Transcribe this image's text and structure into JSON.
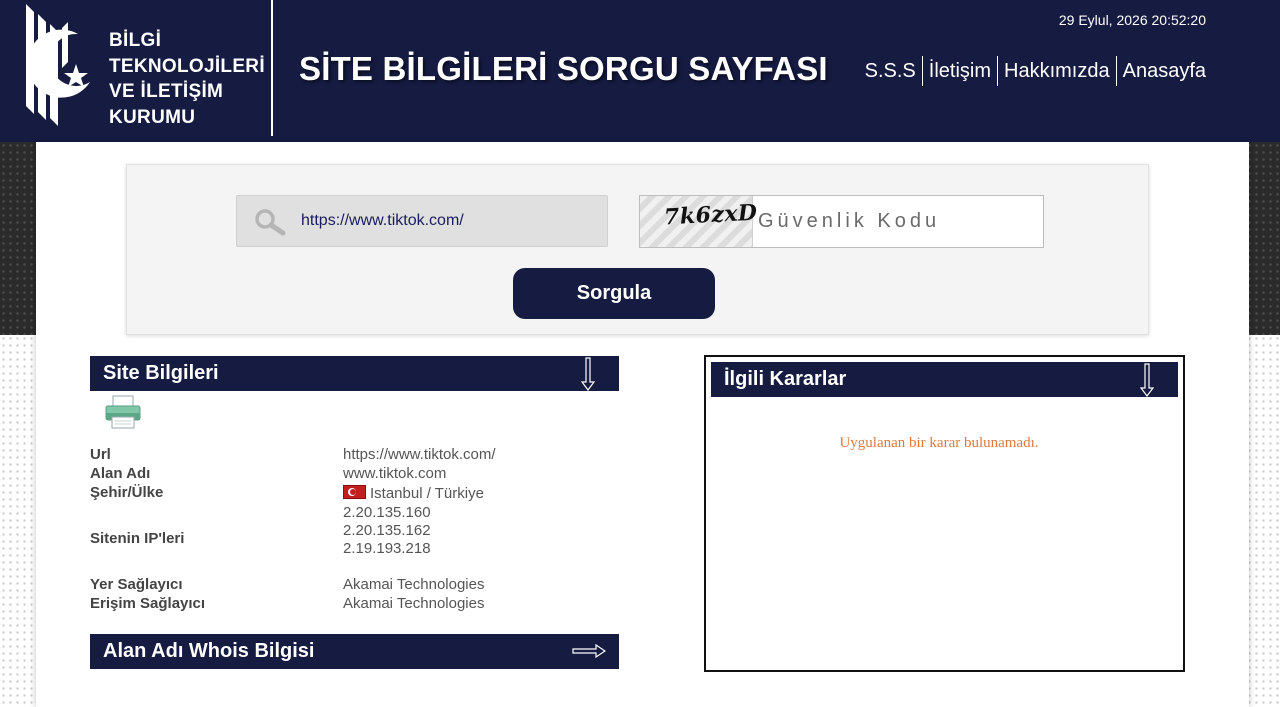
{
  "header": {
    "logo_lines": [
      "BİLGİ",
      "TEKNOLOJİLERİ",
      "VE İLETİŞİM",
      "KURUMU"
    ],
    "page_title": "SİTE BİLGİLERİ SORGU SAYFASI",
    "datetime": "29 Eylul, 2026 20:52:20",
    "nav": [
      {
        "label": "S.S.S"
      },
      {
        "label": "İletişim"
      },
      {
        "label": "Hakkımızda"
      },
      {
        "label": "Anasayfa"
      }
    ]
  },
  "search": {
    "url_value": "https://www.tiktok.com/",
    "search_icon": "magnifier-icon",
    "captcha_text": "7k6zxD",
    "captcha_placeholder": "Güvenlik Kodu",
    "submit_label": "Sorgula"
  },
  "site_info": {
    "title": "Site Bilgileri",
    "toggle_icon": "arrow-down-icon",
    "print_icon": "printer-icon",
    "rows": {
      "url": {
        "label": "Url",
        "value": "https://www.tiktok.com/"
      },
      "domain": {
        "label": "Alan Adı",
        "value": "www.tiktok.com"
      },
      "city": {
        "label": "Şehir/Ülke",
        "value": "Istanbul / Türkiye",
        "flag_icon": "turkey-flag-icon"
      },
      "ips": {
        "label": "Sitenin IP'leri",
        "values": [
          "2.20.135.160",
          "2.20.135.162",
          "2.19.193.218"
        ]
      },
      "host": {
        "label": "Yer Sağlayıcı",
        "value": "Akamai Technologies"
      },
      "access": {
        "label": "Erişim Sağlayıcı",
        "value": "Akamai Technologies"
      }
    }
  },
  "whois": {
    "title": "Alan Adı Whois Bilgisi",
    "toggle_icon": "arrow-right-icon"
  },
  "decisions": {
    "title": "İlgili Kararlar",
    "toggle_icon": "arrow-down-icon",
    "empty_message": "Uygulanan bir karar bulunamadı."
  },
  "colors": {
    "navy": "#161b42",
    "empty_message": "#e07a3c"
  }
}
